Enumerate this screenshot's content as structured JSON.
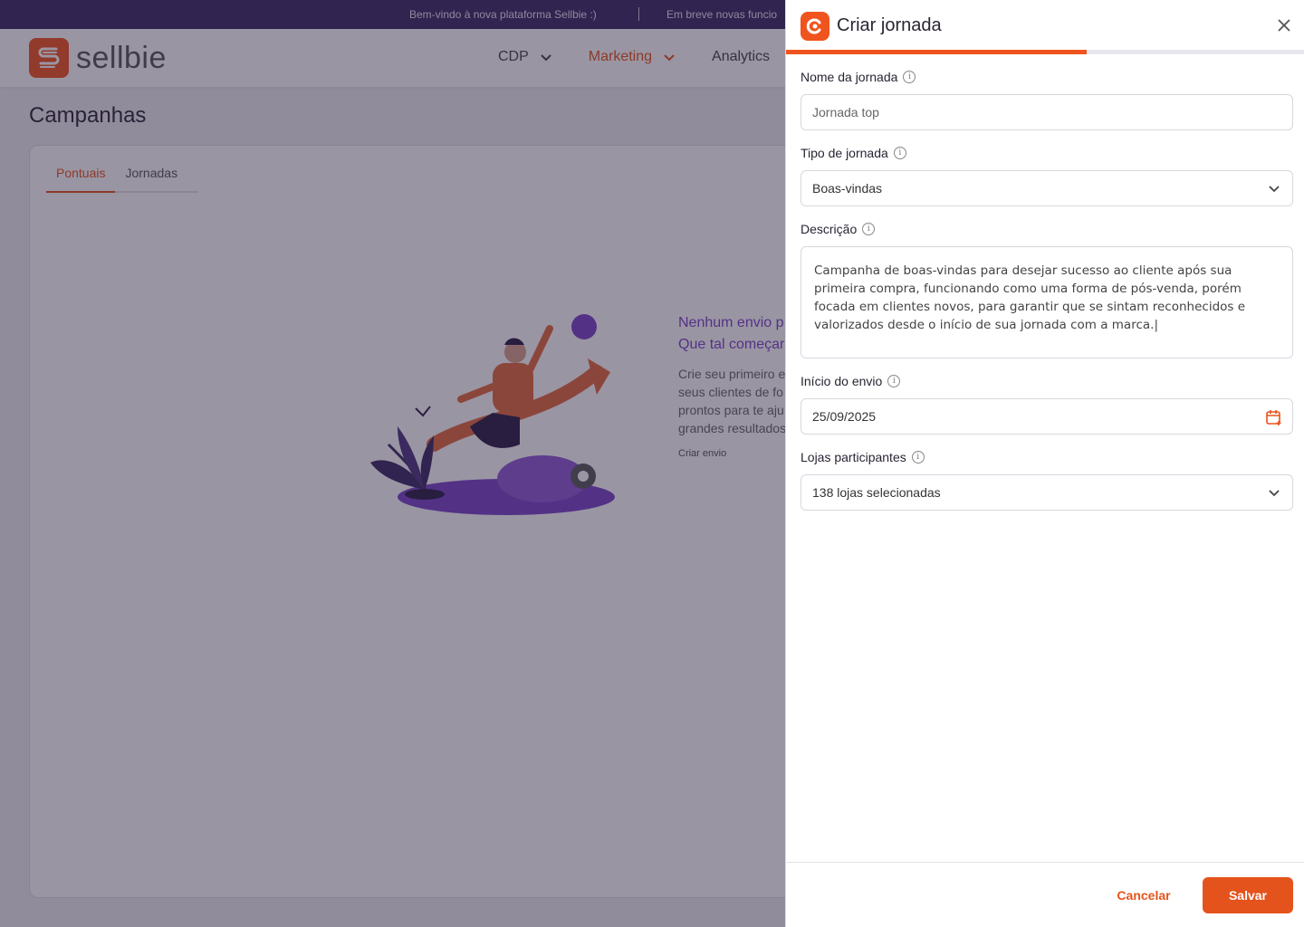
{
  "announcement": {
    "message1": "Bem-vindo à nova plataforma Sellbie :)",
    "message2": "Em breve novas funcio"
  },
  "header": {
    "logo_text": "sellbie",
    "nav": [
      {
        "label": "CDP",
        "active": false
      },
      {
        "label": "Marketing",
        "active": true
      },
      {
        "label": "Analytics",
        "active": false
      }
    ]
  },
  "page": {
    "title": "Campanhas",
    "tabs": [
      {
        "label": "Pontuais",
        "active": true
      },
      {
        "label": "Jornadas",
        "active": false
      }
    ],
    "empty_state": {
      "heading": "Nenhum envio p\nQue tal começar",
      "description": "Crie seu primeiro e\nseus clientes de fo\nprontos para te aju\ngrandes resultados",
      "cta": "Criar envio"
    }
  },
  "drawer": {
    "title": "Criar jornada",
    "progress_fraction": 0.58,
    "fields": {
      "name": {
        "label": "Nome da jornada",
        "value": "Jornada top"
      },
      "type": {
        "label": "Tipo de jornada",
        "value": "Boas-vindas"
      },
      "description": {
        "label": "Descrição",
        "value": "Campanha de boas-vindas para desejar sucesso ao cliente após sua primeira compra, funcionando como uma forma de pós-venda, porém focada em clientes novos, para garantir que se sintam reconhecidos e valorizados desde o início de sua jornada com a marca.|"
      },
      "start": {
        "label": "Início do envio",
        "value": "25/09/2025"
      },
      "stores": {
        "label": "Lojas participantes",
        "value": "138 lojas selecionadas"
      }
    },
    "actions": {
      "cancel": "Cancelar",
      "save": "Salvar"
    }
  },
  "colors": {
    "accent": "#e5531c",
    "announcement_bg": "#3a2a63",
    "illustration_purple": "#7a45c9"
  }
}
